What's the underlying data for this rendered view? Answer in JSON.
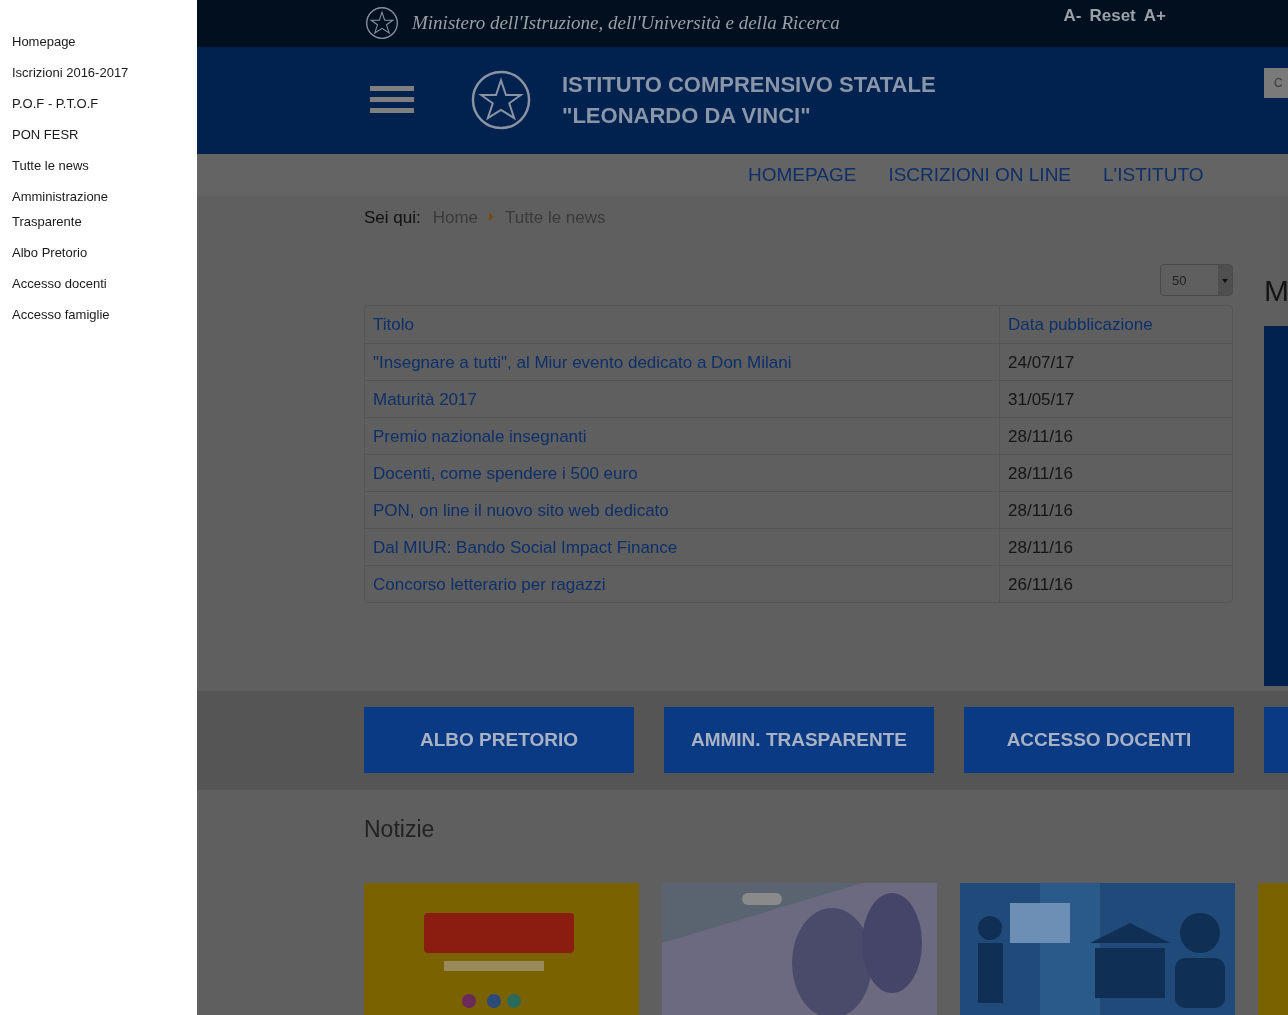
{
  "sidebar": {
    "items": [
      {
        "label": "Homepage"
      },
      {
        "label": "Iscrizioni 2016-2017"
      },
      {
        "label": "P.O.F - P.T.O.F"
      },
      {
        "label": "PON FESR"
      },
      {
        "label": "Tutte le news"
      },
      {
        "label": "Amministrazione Trasparente"
      },
      {
        "label": "Albo Pretorio"
      },
      {
        "label": "Accesso docenti"
      },
      {
        "label": "Accesso famiglie"
      }
    ]
  },
  "top_bar": {
    "ministry": "Ministero dell'Istruzione, dell'Università e della Ricerca",
    "font_controls": [
      "A-",
      "Reset",
      "A+"
    ]
  },
  "header": {
    "title_lines": [
      "ISTITUTO COMPRENSIVO STATALE",
      "\"LEONARDO DA VINCI\""
    ],
    "search": {
      "placeholder": "C"
    }
  },
  "nav": {
    "items": [
      "HOMEPAGE",
      "ISCRIZIONI ON LINE",
      "L'ISTITUTO"
    ]
  },
  "breadcrumb": {
    "label": "Sei qui:",
    "items": [
      "Home",
      "Tutte le news"
    ]
  },
  "page_size": "50",
  "table": {
    "columns": [
      "Titolo",
      "Data pubblicazione"
    ],
    "rows": [
      [
        "\"Insegnare a tutti\", al Miur evento dedicato a Don Milani",
        "24/07/17"
      ],
      [
        "Maturità 2017",
        "31/05/17"
      ],
      [
        "Premio nazionale insegnanti",
        "28/11/16"
      ],
      [
        "Docenti, come spendere i 500 euro",
        "28/11/16"
      ],
      [
        "PON, on line il nuovo sito web dedicato",
        "28/11/16"
      ],
      [
        "Dal MIUR: Bando Social Impact Finance",
        "28/11/16"
      ],
      [
        "Concorso letterario per ragazzi",
        "26/11/16"
      ]
    ]
  },
  "side_heading": "M",
  "quick_links": [
    "ALBO PRETORIO",
    "AMMIN. TRASPARENTE",
    "ACCESSO DOCENTI"
  ],
  "news": {
    "title": "Notizie"
  }
}
